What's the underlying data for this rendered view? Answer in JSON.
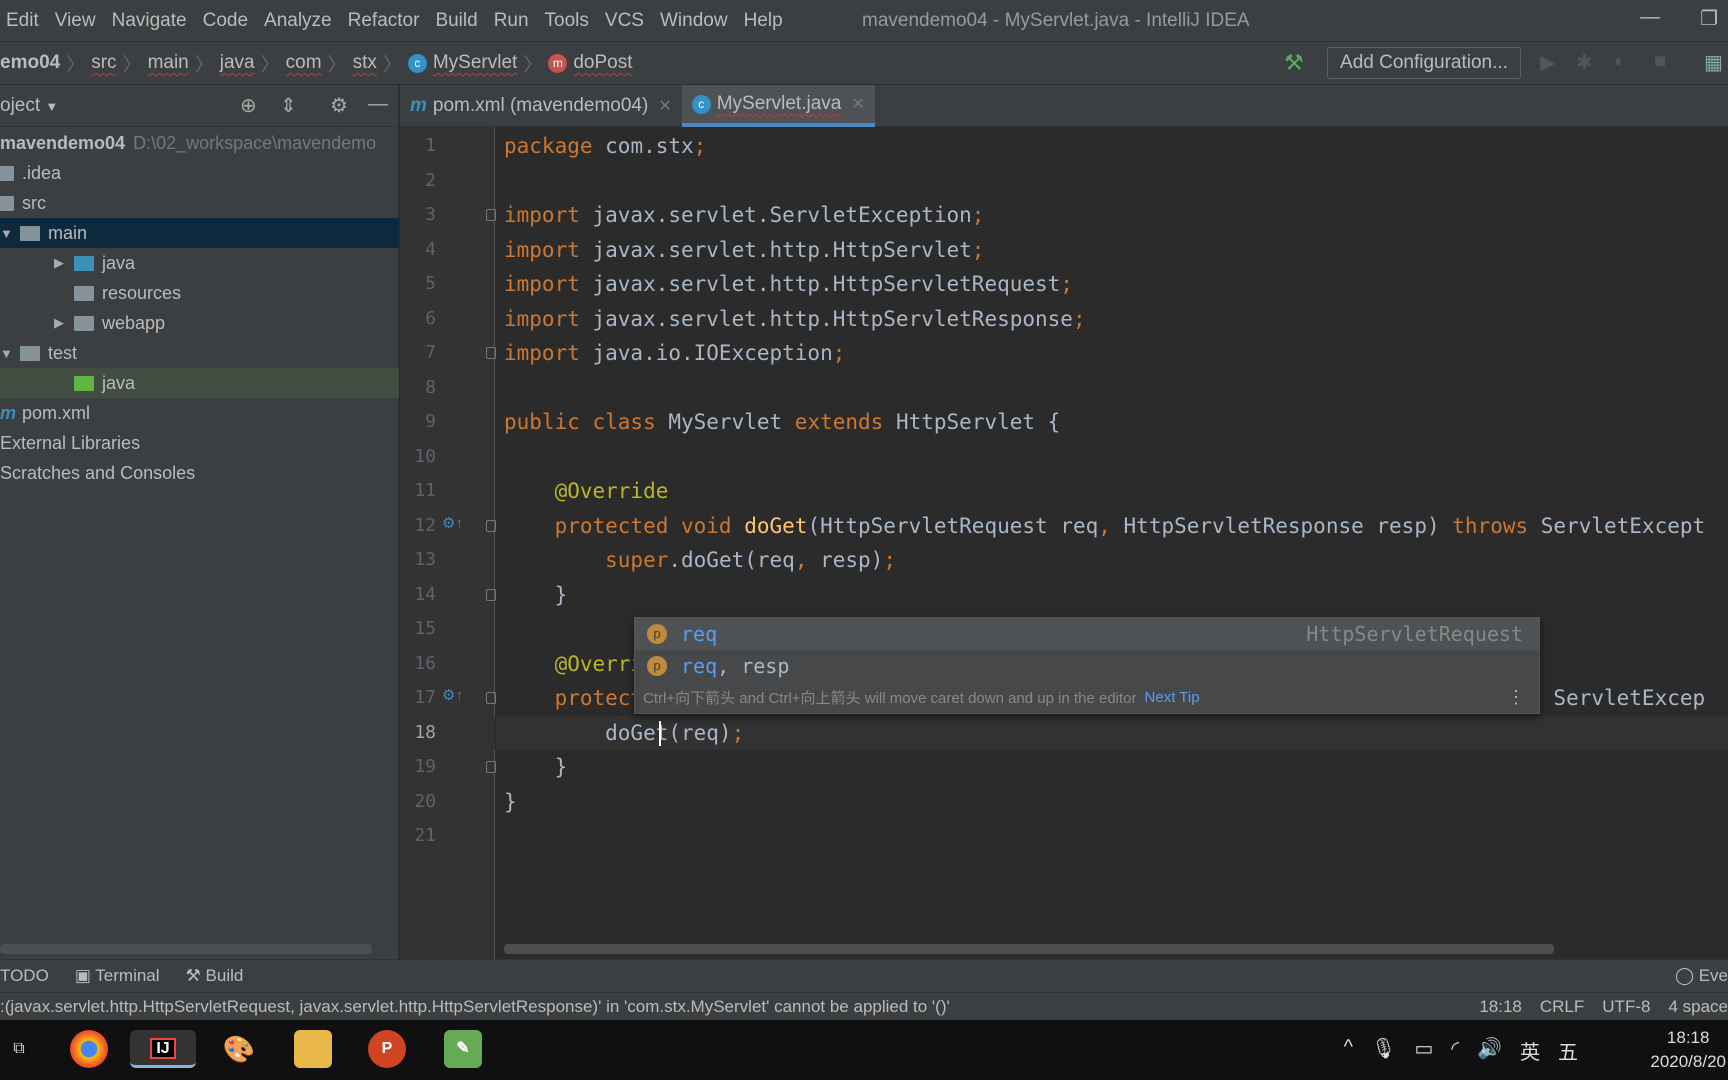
{
  "menu": [
    "Edit",
    "View",
    "Navigate",
    "Code",
    "Analyze",
    "Refactor",
    "Build",
    "Run",
    "Tools",
    "VCS",
    "Window",
    "Help"
  ],
  "window_title": "mavendemo04 - MyServlet.java - IntelliJ IDEA",
  "breadcrumb": [
    "emo04",
    "src",
    "main",
    "java",
    "com",
    "stx",
    "MyServlet",
    "doPost"
  ],
  "toolbar": {
    "add_configuration": "Add Configuration..."
  },
  "project": {
    "title": "oject",
    "tree": [
      {
        "label": "mavendemo04",
        "extra": "D:\\02_workspace\\mavendemo",
        "indent": 0,
        "icon": "none"
      },
      {
        "label": ".idea",
        "indent": 0,
        "icon": "folder"
      },
      {
        "label": "src",
        "indent": 0,
        "icon": "folder"
      },
      {
        "label": "main",
        "indent": 1,
        "icon": "folder",
        "arrow": "▼",
        "selected": true
      },
      {
        "label": "java",
        "indent": 2,
        "icon": "folder-blue",
        "arrow": "▶"
      },
      {
        "label": "resources",
        "indent": 2,
        "icon": "folder-resources"
      },
      {
        "label": "webapp",
        "indent": 2,
        "icon": "folder",
        "arrow": "▶"
      },
      {
        "label": "test",
        "indent": 1,
        "icon": "folder",
        "arrow": "▼"
      },
      {
        "label": "java",
        "indent": 2,
        "icon": "folder-green",
        "highlighted": true
      },
      {
        "label": "pom.xml",
        "indent": 0,
        "icon": "maven"
      },
      {
        "label": "External Libraries",
        "indent": 0,
        "icon": "none"
      },
      {
        "label": "Scratches and Consoles",
        "indent": 0,
        "icon": "none"
      }
    ]
  },
  "tabs": [
    {
      "label": "pom.xml (mavendemo04)",
      "icon": "maven"
    },
    {
      "label": "MyServlet.java",
      "icon": "class",
      "active": true
    }
  ],
  "code": [
    [
      [
        "package",
        "kw"
      ],
      [
        " com.stx",
        "pl"
      ],
      [
        ";",
        "kw"
      ]
    ],
    [],
    [
      [
        "import",
        "kw"
      ],
      [
        " javax.servlet.ServletException",
        "pl"
      ],
      [
        ";",
        "kw"
      ]
    ],
    [
      [
        "import",
        "kw"
      ],
      [
        " javax.servlet.http.HttpServlet",
        "pl"
      ],
      [
        ";",
        "kw"
      ]
    ],
    [
      [
        "import",
        "kw"
      ],
      [
        " javax.servlet.http.HttpServletRequest",
        "pl"
      ],
      [
        ";",
        "kw"
      ]
    ],
    [
      [
        "import",
        "kw"
      ],
      [
        " javax.servlet.http.HttpServletResponse",
        "pl"
      ],
      [
        ";",
        "kw"
      ]
    ],
    [
      [
        "import",
        "kw"
      ],
      [
        " java.io.IOException",
        "pl"
      ],
      [
        ";",
        "kw"
      ]
    ],
    [],
    [
      [
        "public class",
        "kw"
      ],
      [
        " MyServlet ",
        "pl"
      ],
      [
        "extends",
        "kw"
      ],
      [
        " HttpServlet {",
        "pl"
      ]
    ],
    [],
    [
      [
        "    @Override",
        "an"
      ]
    ],
    [
      [
        "    protected void ",
        "kw"
      ],
      [
        "doGet",
        "fn"
      ],
      [
        "(HttpServletRequest req",
        "pl"
      ],
      [
        ", ",
        "kw"
      ],
      [
        "HttpServletResponse resp) ",
        "pl"
      ],
      [
        "throws ",
        "kw"
      ],
      [
        "ServletExcept",
        "pl"
      ]
    ],
    [
      [
        "        super",
        "kw"
      ],
      [
        ".doGet(req",
        "pl"
      ],
      [
        ", ",
        "kw"
      ],
      [
        "resp)",
        "pl"
      ],
      [
        ";",
        "kw"
      ]
    ],
    [
      [
        "    }",
        "pl"
      ]
    ],
    [],
    [
      [
        "    @Override",
        "an"
      ]
    ],
    [
      [
        "    protected void ",
        "kw"
      ],
      [
        "doPost",
        "fn"
      ],
      [
        "(HttpServletRequest req",
        "pl"
      ],
      [
        ", ",
        "kw"
      ],
      [
        "HttpServletResponse resp) ",
        "pl"
      ],
      [
        "throws ",
        "kw"
      ],
      [
        "ServletExcep",
        "pl"
      ]
    ],
    [
      [
        "        doGet(req)",
        "pl"
      ],
      [
        ";",
        "kw"
      ]
    ],
    [
      [
        "    }",
        "pl"
      ]
    ],
    [
      [
        "}",
        "pl"
      ]
    ],
    []
  ],
  "current_line": 18,
  "completion": {
    "items": [
      {
        "label": "req",
        "type": "HttpServletRequest",
        "badge": "p"
      },
      {
        "label": "req, resp",
        "type": "",
        "badge": "p"
      }
    ],
    "tip": "Ctrl+向下箭头 and Ctrl+向上箭头 will move caret down and up in the editor",
    "next_tip": "Next Tip"
  },
  "toolstrip": [
    "TODO",
    "Terminal",
    "Build"
  ],
  "event_log": "Eve",
  "status": {
    "message": ":(javax.servlet.http.HttpServletRequest, javax.servlet.http.HttpServletResponse)' in 'com.stx.MyServlet' cannot be applied to '()'",
    "position": "18:18",
    "line_sep": "CRLF",
    "encoding": "UTF-8",
    "indent": "4 space"
  },
  "taskbar": {
    "apps": [
      "chrome",
      "intellij",
      "paint",
      "explorer",
      "powerpoint",
      "notepad"
    ],
    "ime": "英",
    "ime2": "五",
    "time": "18:18",
    "date": "2020/8/20"
  },
  "colors": {
    "keyword": "#cc7832",
    "annotation": "#bbb529",
    "method": "#ffc66d",
    "text": "#a9b7c6",
    "accent": "#4a88c7"
  }
}
